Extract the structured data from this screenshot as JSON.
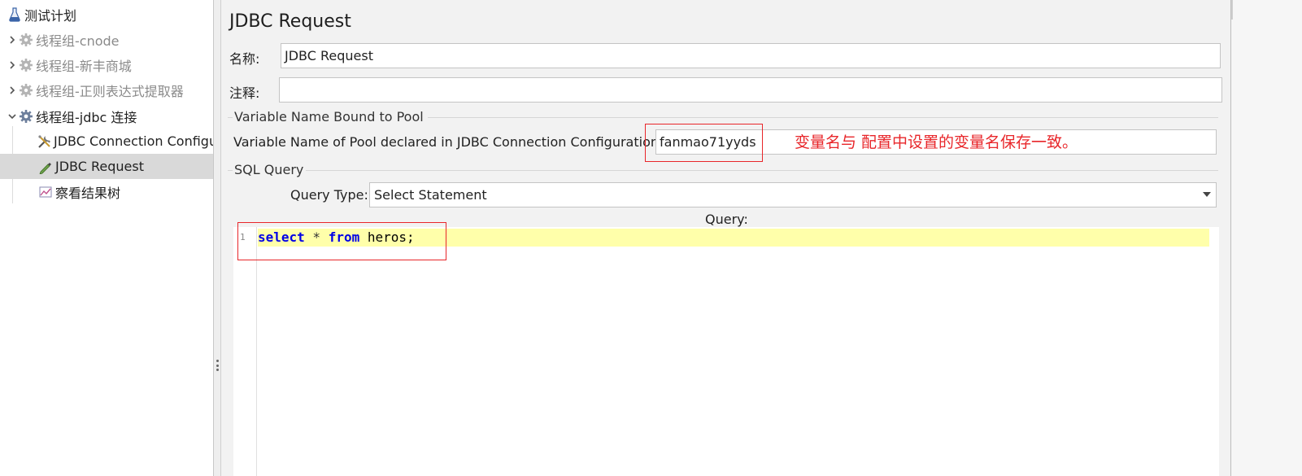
{
  "tree": {
    "items": [
      {
        "label": "测试计划",
        "icon": "test-plan-flask-icon",
        "arrow": "",
        "disabled": false,
        "selected": false
      },
      {
        "label": "线程组-cnode",
        "icon": "gear-icon",
        "arrow": "chevron-right-icon",
        "disabled": true,
        "selected": false
      },
      {
        "label": "线程组-新丰商城",
        "icon": "gear-icon",
        "arrow": "chevron-right-icon",
        "disabled": true,
        "selected": false
      },
      {
        "label": "线程组-正则表达式提取器",
        "icon": "gear-icon",
        "arrow": "chevron-right-icon",
        "disabled": true,
        "selected": false
      },
      {
        "label": "线程组-jdbc 连接",
        "icon": "gear-icon",
        "arrow": "chevron-down-icon",
        "disabled": false,
        "selected": false
      },
      {
        "label": "JDBC Connection Configu",
        "icon": "wrench-icon",
        "arrow": "",
        "disabled": false,
        "selected": false
      },
      {
        "label": "JDBC Request",
        "icon": "sampler-pen-icon",
        "arrow": "",
        "disabled": false,
        "selected": true
      },
      {
        "label": "察看结果树",
        "icon": "graph-icon",
        "arrow": "",
        "disabled": false,
        "selected": false
      }
    ]
  },
  "panel": {
    "title": "JDBC Request",
    "name_label": "名称:",
    "name_value": "JDBC Request",
    "comment_label": "注释:",
    "comment_value": "",
    "pool_section_title": "Variable Name Bound to Pool",
    "pool_label": "Variable Name of Pool declared in JDBC Connection Configuration:",
    "pool_value": "fanmao71yyds",
    "sql_section_title": "SQL Query",
    "query_type_label": "Query Type:",
    "query_type_value": "Select Statement",
    "query_label": "Query:",
    "editor": {
      "line_number": "1",
      "tokens": {
        "kw1": "select",
        "op": " * ",
        "kw2": "from",
        "rest": " heros;"
      }
    }
  },
  "annotation": {
    "text": "变量名与 配置中设置的变量名保存一致。",
    "color": "#e8262a"
  },
  "colors": {
    "selected_row": "#d9d9d9",
    "panel_bg": "#f2f2f2",
    "current_line": "#ffffaa",
    "keyword": "#0000e6"
  }
}
